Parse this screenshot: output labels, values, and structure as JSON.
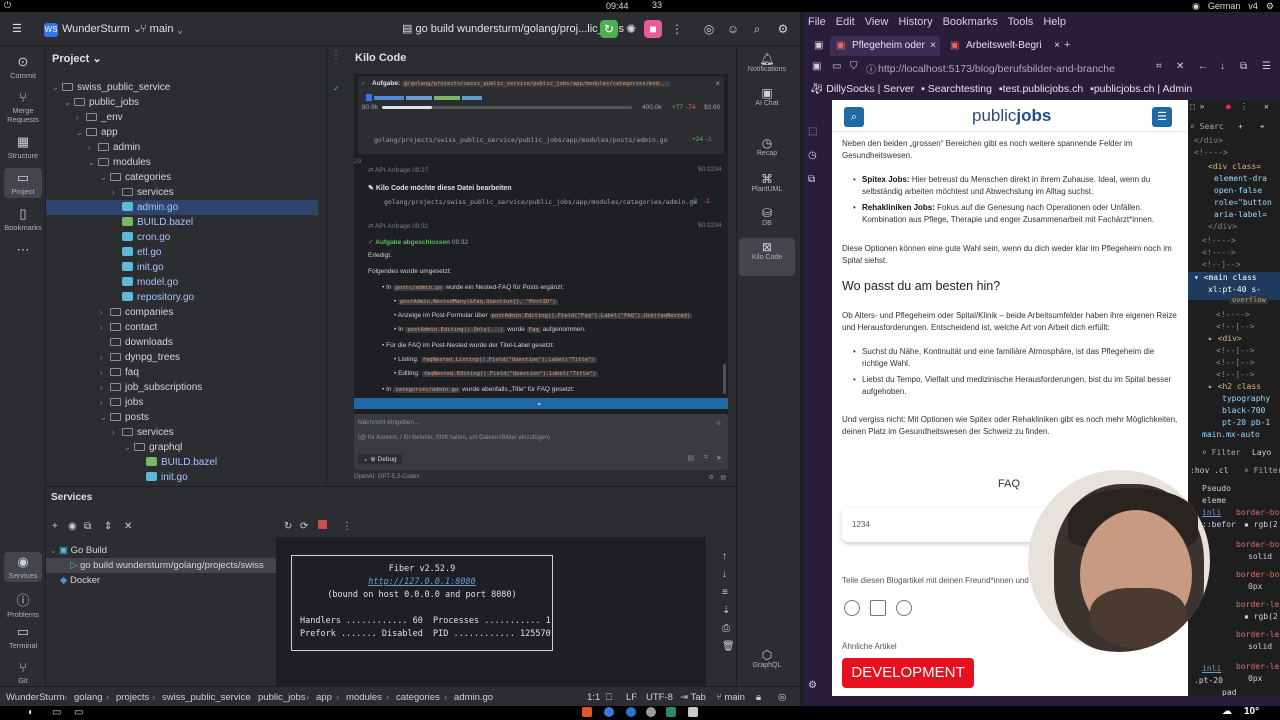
{
  "system": {
    "time": "09:44",
    "notifications": "33",
    "keyboard": "German",
    "version": "v4",
    "weather": "10°"
  },
  "ide": {
    "project_name": "WunderSturm",
    "project_badge": "WS",
    "branch": "main",
    "run_config": "go build wundersturm/golang/proj...lic_jobs",
    "left_strip": [
      "Commit",
      "Merge Requests",
      "Structure",
      "Project",
      "Bookmarks"
    ],
    "bottom_strip": [
      "Services",
      "Problems",
      "Terminal",
      "Git"
    ],
    "project_panel_title": "Project",
    "tree": [
      {
        "label": "swiss_public_service",
        "type": "folder",
        "open": true,
        "level": 2
      },
      {
        "label": "public_jobs",
        "type": "folder",
        "open": true,
        "level": 3
      },
      {
        "label": "_env",
        "type": "folder",
        "open": false,
        "level": 4
      },
      {
        "label": "app",
        "type": "folder",
        "open": true,
        "level": 4
      },
      {
        "label": "admin",
        "type": "folder",
        "open": false,
        "level": 5
      },
      {
        "label": "modules",
        "type": "folder",
        "open": true,
        "level": 5
      },
      {
        "label": "categories",
        "type": "folder",
        "open": true,
        "level": 6
      },
      {
        "label": "services",
        "type": "folder",
        "open": false,
        "level": 7
      },
      {
        "label": "admin.go",
        "type": "go",
        "level": 7,
        "selected": true
      },
      {
        "label": "BUILD.bazel",
        "type": "bazel",
        "level": 7
      },
      {
        "label": "cron.go",
        "type": "go",
        "level": 7
      },
      {
        "label": "etl.go",
        "type": "go",
        "level": 7
      },
      {
        "label": "init.go",
        "type": "go",
        "level": 7
      },
      {
        "label": "model.go",
        "type": "go",
        "level": 7,
        "highlight": true
      },
      {
        "label": "repository.go",
        "type": "go",
        "level": 7
      },
      {
        "label": "companies",
        "type": "folder",
        "open": false,
        "level": 6
      },
      {
        "label": "contact",
        "type": "folder",
        "open": false,
        "level": 6
      },
      {
        "label": "downloads",
        "type": "folder",
        "open": false,
        "level": 6,
        "noarrow": true
      },
      {
        "label": "dynpg_trees",
        "type": "folder",
        "open": false,
        "level": 6
      },
      {
        "label": "faq",
        "type": "folder",
        "open": false,
        "level": 6
      },
      {
        "label": "job_subscriptions",
        "type": "folder",
        "open": false,
        "level": 6
      },
      {
        "label": "jobs",
        "type": "folder",
        "open": false,
        "level": 6
      },
      {
        "label": "posts",
        "type": "folder",
        "open": true,
        "level": 6
      },
      {
        "label": "services",
        "type": "folder",
        "open": false,
        "level": 7,
        "open2": true
      },
      {
        "label": "graphql",
        "type": "folder",
        "open": true,
        "level": 8
      },
      {
        "label": "BUILD.bazel",
        "type": "bazel",
        "level": 9
      },
      {
        "label": "init.go",
        "type": "go",
        "level": 9
      }
    ],
    "kilo": {
      "title": "Kilo Code",
      "task_label": "Aufgabe:",
      "task_path": "@/golang/projects/swiss_public_service/public_jobs/app/modules/categories/mod...",
      "stats_left": "80.9k",
      "stats_mid": "400.0k",
      "stats_plus": "+77",
      "stats_minus": "-74",
      "stats_cost": "$0.60",
      "diff_line_no": [
        "27",
        "28",
        "29"
      ],
      "diff_path": "golang/projects/swiss_public_service/public_jobs/app/modules/posts/admin.go",
      "diff1_plus": "+24",
      "diff1_minus": "-1",
      "api_req1": "API-Anfrage",
      "api_time1": "09:27",
      "api_cost1": "$0.0234",
      "edit_title": "Kilo Code möchte diese Datei bearbeiten",
      "edit_path": "golang/projects/swiss_public_service/public_jobs/app/modules/categories/admin.go",
      "diff2_plus": "+2",
      "diff2_minus": "-1",
      "api_req2": "API-Anfrage",
      "api_time2": "09:32",
      "api_cost2": "$0.0234",
      "done_title": "Aufgabe abgeschlossen",
      "done_time": "09:32",
      "done_text1": "Erledigt.",
      "done_text2": "Folgendes wurde umgesetzt:",
      "b1_pre": "In",
      "b1_code": "posts/admin.go",
      "b1_post": "wurde ein Nested-FAQ für Posts ergänzt:",
      "b1a_code": "postAdmin.NestedMany(&faq.Question{}, \"PostID\")",
      "b1b_pre": "Anzeige im Post-Formular über",
      "b1b_code": "postAdmin.Editing().Field(\"Faq\").Label(\"FAQ\").Use(faqNested)",
      "b1c_pre": "In",
      "b1c_code": "postAdmin.Editing().Only(...)",
      "b1c_mid": "wurde",
      "b1c_code2": "Faq",
      "b1c_post": "aufgenommen.",
      "b2": "Für die FAQ im Post-Nested wurde der Titel-Label gesetzt:",
      "b2a_pre": "Listing:",
      "b2a_code": "faqNested.Listing().Field(\"Question\").Label(\"Title\")",
      "b2b_pre": "Editing:",
      "b2b_code": "faqNested.Editing().Field(\"Question\").Label(\"Title\")",
      "b3_pre": "In",
      "b3_code": "categories/admin.go",
      "b3_post": "wurde ebenfalls „Title“ für FAQ gesetzt:",
      "input_placeholder": "Nachricht eingeben...",
      "input_hint": "(@ für Kontext, / für Befehle, Shift halten, um Dateien/Bilder einzufügen)",
      "mode": "Debug",
      "footer_model": "OpenAI: GPT-5.3-Codex"
    },
    "right_strip": [
      "Notifications",
      "AI Chat",
      "Recap",
      "PlantUML",
      "DB",
      "Kilo Code",
      "GraphQL"
    ],
    "services": {
      "title": "Services",
      "group": "Go Build",
      "run_item": "go build wundersturm/golang/projects/swiss",
      "docker": "Docker"
    },
    "console": {
      "l1": "Fiber v2.52.9",
      "l2": "http://127.0.0.1:8080",
      "l3": "(bound on host 0.0.0.0 and port 8080)",
      "l4": "Handlers ............ 60  Processes ........... 1",
      "l5": "Prefork ....... Disabled  PID ............ 125570"
    },
    "status": {
      "breadcrumbs": [
        "WunderSturm",
        "golang",
        "projects",
        "swiss_public_service",
        "public_jobs",
        "app",
        "modules",
        "categories",
        "admin.go"
      ],
      "position": "1:1",
      "line_ending": "LF",
      "encoding": "UTF-8",
      "indent": "Tab",
      "branch": "main"
    }
  },
  "browser": {
    "menu": [
      "File",
      "Edit",
      "View",
      "History",
      "Bookmarks",
      "Tools",
      "Help"
    ],
    "tabs": [
      "Pflegeheim oder",
      "Arbeitswelt-Begri"
    ],
    "url": "http://localhost:5173/blog/berufsbilder-and-branche",
    "bookmarks": [
      "DillySocks | Server",
      "Searchtesting",
      "test.publicjobs.ch",
      "publicjobs.ch | Admin"
    ],
    "site": {
      "logo_a": "public",
      "logo_b": "jobs",
      "p1": "Neben den beiden „grossen“ Bereichen gibt es noch weitere spannende Felder im Gesundheitswesen.",
      "li1_b": "Spitex Jobs:",
      "li1": "Hier betreust du Menschen direkt in ihrem Zuhause. Ideal, wenn du selbständig arbeiten möchtest und Abwechslung im Alltag suchst.",
      "li2_b": "Rehakliniken Jobs:",
      "li2": "Fokus auf die Genesung nach Operationen oder Unfällen. Kombination aus Pflege, Therapie und enger Zusammenarbeit mit Fachärzt*innen.",
      "p2": "Diese Optionen können eine gute Wahl sein, wenn du dich weder klar im Pflegeheim noch im Spital siehst.",
      "h2": "Wo passt du am besten hin?",
      "p3": "Ob Alters- und Pflegeheim oder Spital/Klinik – beide Arbeitsumfelder haben ihre eigenen Reize und Herausforderungen. Entscheidend ist, welche Art von Arbeit dich erfüllt:",
      "li3": "Suchst du Nähe, Kontinuität und eine familiäre Atmosphäre, ist das Pflegeheim die richtige Wahl.",
      "li4": "Liebst du Tempo, Vielfalt und medizinische Herausforderungen, bist du im Spital besser aufgehoben.",
      "p4": "Und vergiss nicht: Mit Optionen wie Spitex oder Rehakliniken gibt es noch mehr Möglichkeiten, deinen Platz im Gesundheitswesen der Schweiz zu finden.",
      "faq": "FAQ",
      "faq_item": "1234",
      "share": "Teile diesen Blogartikel mit deinen Freund*innen und",
      "similar": "Ähnliche Artikel",
      "badge": "DEVELOPMENT"
    },
    "devtools": {
      "search": "Searc",
      "filter": "Filter",
      "tab2": "Layo",
      "crumb": "main.mx-auto",
      "overflow": "overflow"
    }
  },
  "colors": {
    "accent": "#3574f0",
    "kilo_blue": "#1f6aa5",
    "badge_red": "#e8101f",
    "run_green": "#4caf50",
    "stop_pink": "#e85a9a"
  }
}
